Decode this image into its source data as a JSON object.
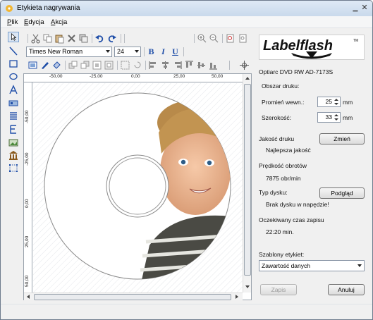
{
  "window": {
    "title": "Etykieta nagrywania"
  },
  "menu": [
    {
      "label": "Plik",
      "u": "P",
      "rest": "lik"
    },
    {
      "label": "Edycja",
      "u": "E",
      "rest": "dycja"
    },
    {
      "label": "Akcja",
      "u": "A",
      "rest": "kcja"
    }
  ],
  "font": {
    "family": "Times New Roman",
    "size": "24"
  },
  "format": {
    "bold": "B",
    "italic": "I",
    "underline": "U"
  },
  "ruler": {
    "h_ticks": [
      "-50,00",
      "-25,00",
      "0,00",
      "25,00",
      "50,00"
    ],
    "v_ticks": [
      "-50,00",
      "-25,00",
      "0,00",
      "25,00",
      "50,00"
    ]
  },
  "panel": {
    "logo_text": "Labelflash",
    "logo_tm": "TM",
    "drive": "Optiarc DVD RW AD-7173S",
    "print_area_label": "Obszar druku:",
    "inner_radius_label": "Promień wewn.:",
    "inner_radius_value": "25",
    "inner_radius_unit": "mm",
    "width_label": "Szerokość:",
    "width_value": "33",
    "width_unit": "mm",
    "quality_label": "Jakość druku",
    "quality_value": "Najlepsza jakość",
    "change_button": "Zmień",
    "speed_label": "Prędkość obrotów",
    "speed_value": "7875 obr/min",
    "disc_type_label": "Typ dysku:",
    "disc_type_value": "Brak dysku w napędzie!",
    "preview_button": "Podgląd",
    "time_label": "Oczekiwany czas zapisu",
    "time_value": "22:20 min.",
    "templates_label": "Szablony etykiet:",
    "templates_selected": "Zawartość danych",
    "save_button": "Zapis",
    "cancel_button": "Anuluj"
  },
  "colors": {
    "accent": "#1f4ea8",
    "title_bg": "#c9d9ec"
  }
}
